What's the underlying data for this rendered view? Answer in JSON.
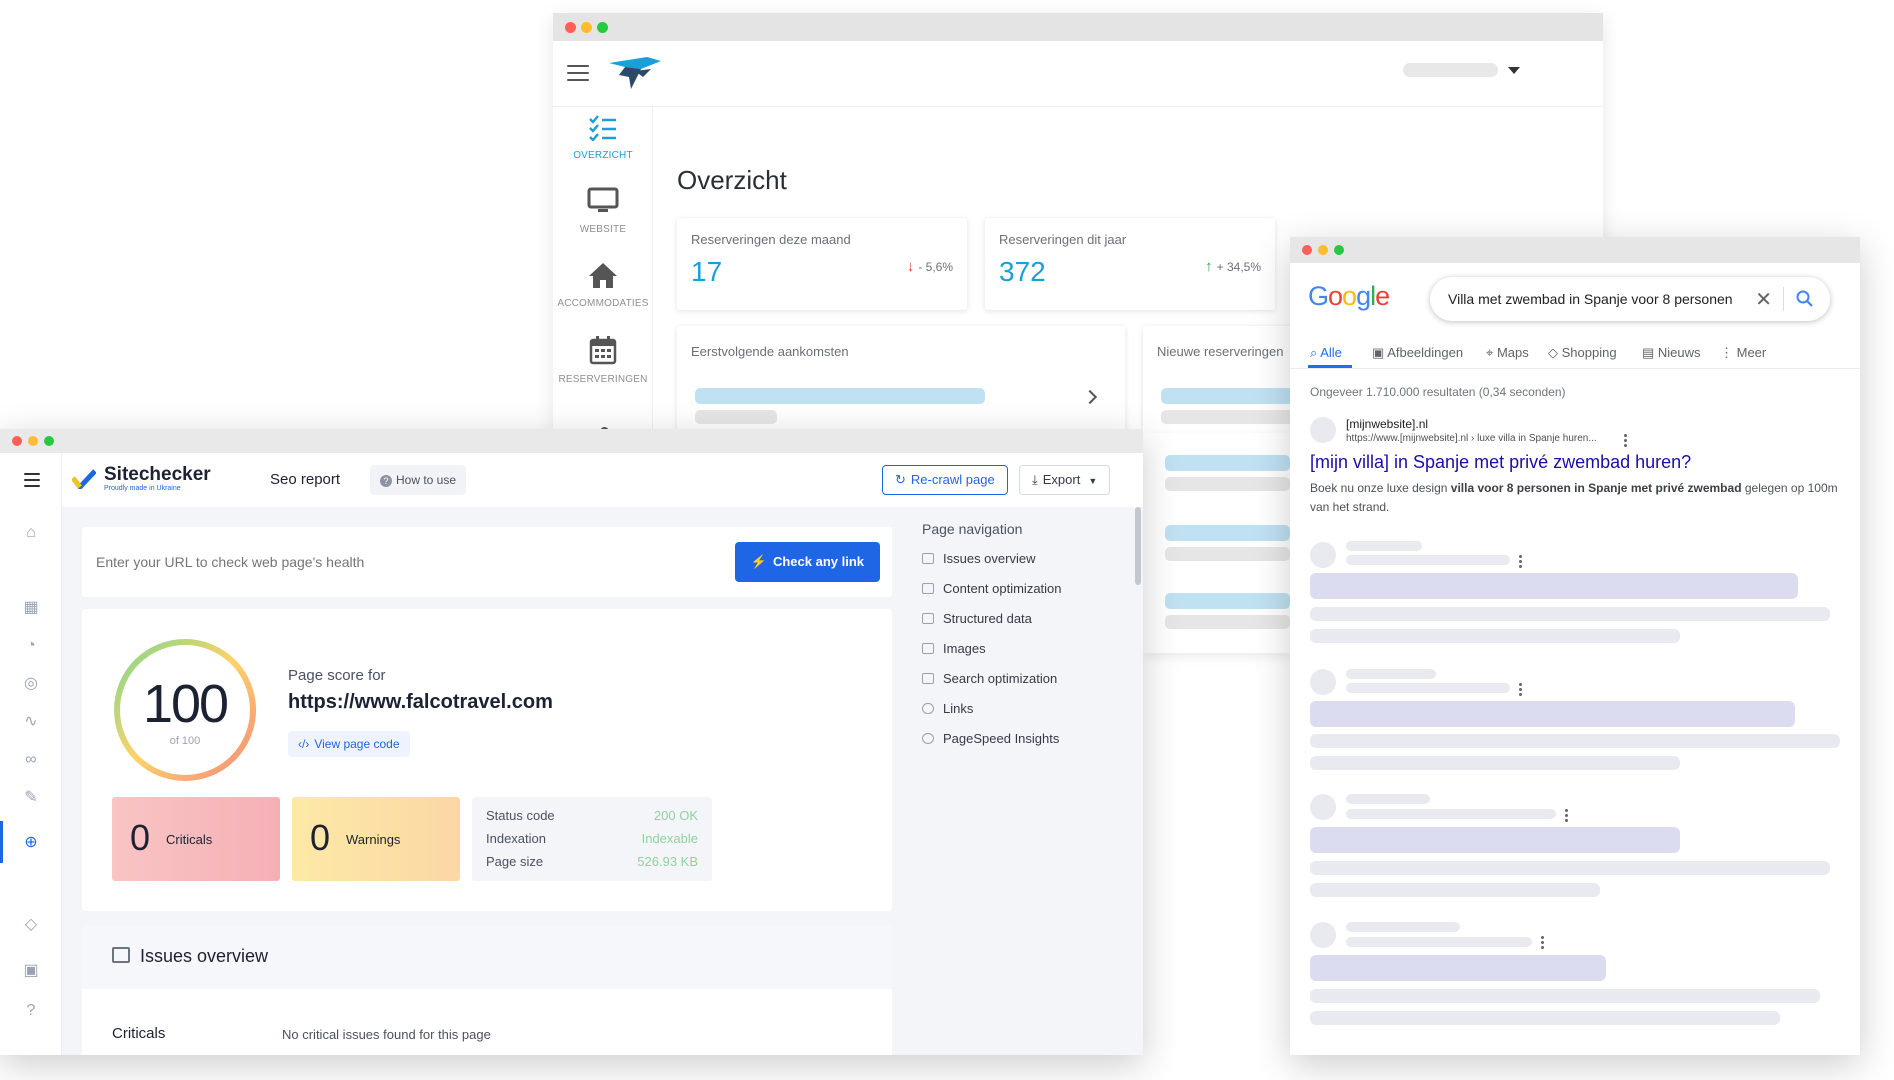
{
  "colors": {
    "falco_blue": "#1a9fd9",
    "sitechecker_blue": "#1e66e6",
    "google_link": "#1a0dab",
    "success_green": "#8fd19e"
  },
  "dashboard": {
    "title": "Overzicht",
    "nav": [
      {
        "label": "OVERZICHT",
        "icon": "checklist-icon"
      },
      {
        "label": "WEBSITE",
        "icon": "monitor-icon"
      },
      {
        "label": "ACCOMMODATIES",
        "icon": "home-icon"
      },
      {
        "label": "RESERVERINGEN",
        "icon": "calendar-icon"
      }
    ],
    "stats": [
      {
        "label": "Reserveringen deze maand",
        "value": "17",
        "change": "- 5,6%"
      },
      {
        "label": "Reserveringen dit jaar",
        "value": "372",
        "change": "+ 34,5%"
      }
    ],
    "panels": {
      "arrivals": "Eerstvolgende aankomsten",
      "new_reservations": "Nieuwe reserveringen"
    }
  },
  "sitechecker": {
    "brand": "Sitechecker",
    "tagline": "Proudly made in Ukraine",
    "section": "Seo report",
    "how_to_use": "How to use",
    "recrawl": "Re-crawl page",
    "export": "Export",
    "url_placeholder": "Enter your URL to check web page's health",
    "check_button": "Check any link",
    "score": "100",
    "score_of": "of 100",
    "score_for": "Page score for",
    "url": "https://www.falcotravel.com",
    "view_code": "View page code",
    "criticals_count": "0",
    "criticals_label": "Criticals",
    "warnings_count": "0",
    "warnings_label": "Warnings",
    "details": [
      {
        "label": "Status code",
        "value": "200 OK"
      },
      {
        "label": "Indexation",
        "value": "Indexable"
      },
      {
        "label": "Page size",
        "value": "526.93 KB"
      }
    ],
    "page_nav_title": "Page navigation",
    "page_nav": [
      "Issues overview",
      "Content optimization",
      "Structured data",
      "Images",
      "Search optimization",
      "Links",
      "PageSpeed Insights"
    ],
    "issues_title": "Issues overview",
    "issues_row_label": "Criticals",
    "issues_row_value": "No critical issues found for this page"
  },
  "google": {
    "logo": "Google",
    "query": "Villa met zwembad in Spanje voor 8 personen",
    "tabs": [
      "Alle",
      "Afbeeldingen",
      "Maps",
      "Shopping",
      "Nieuws",
      "Meer"
    ],
    "results_stats": "Ongeveer 1.710.000 resultaten (0,34 seconden)",
    "result": {
      "site": "[mijnwebsite].nl",
      "url": "https://www.[mijnwebsite].nl › luxe villa in Spanje huren...",
      "title": "[mijn villa] in Spanje met privé zwembad huren?",
      "snippet_1": "Boek nu onze luxe design ",
      "snippet_bold": "villa voor 8 personen in Spanje met privé zwembad",
      "snippet_2": " gelegen op 100m van het strand."
    }
  }
}
